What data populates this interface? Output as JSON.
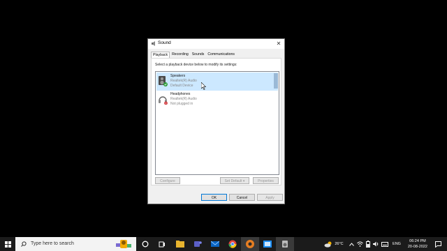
{
  "dialog": {
    "title": "Sound",
    "close": "✕",
    "tabs": [
      "Playback",
      "Recording",
      "Sounds",
      "Communications"
    ],
    "instruction": "Select a playback device below to modify its settings:",
    "devices": [
      {
        "name": "Speakers",
        "driver": "Realtek(R) Audio",
        "status": "Default Device",
        "selected": true
      },
      {
        "name": "Headphones",
        "driver": "Realtek(R) Audio",
        "status": "Not plugged in",
        "selected": false
      }
    ],
    "buttons": {
      "configure": "Configure",
      "set_default": "Set Default",
      "set_default_arrow": "▾",
      "properties": "Properties",
      "ok": "OK",
      "cancel": "Cancel",
      "apply": "Apply"
    }
  },
  "taskbar": {
    "search_placeholder": "Type here to search",
    "weather": "26°C",
    "language": "ENG",
    "time": "06:24 PM",
    "date": "20-08-2022"
  }
}
